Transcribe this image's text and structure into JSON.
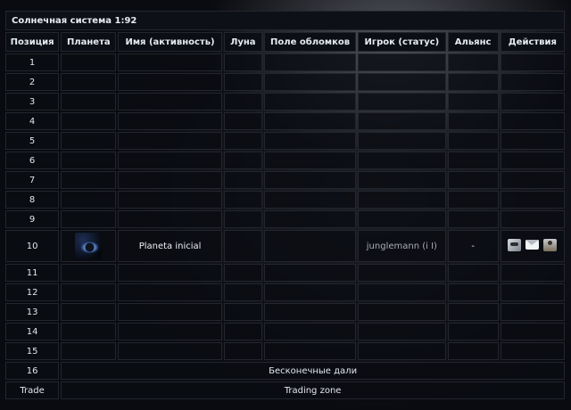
{
  "title": "Солнечная система 1:92",
  "headers": [
    "Позиция",
    "Планета",
    "Имя (активность)",
    "Луна",
    "Поле обломков",
    "Игрок (статус)",
    "Альянс",
    "Действия"
  ],
  "empty_positions_top": [
    "1",
    "2",
    "3",
    "4",
    "5",
    "6",
    "7",
    "8",
    "9"
  ],
  "occupied": {
    "position": "10",
    "planet_icon": "planet-thumbnail",
    "planet_name": "Planeta inicial",
    "moon": "",
    "debris": "",
    "player": "junglemann (i I)",
    "alliance": "-",
    "actions": [
      "spy-icon",
      "message-icon",
      "buddy-request-icon"
    ]
  },
  "empty_positions_bottom": [
    "11",
    "12",
    "13",
    "14",
    "15"
  ],
  "expedition": {
    "position": "16",
    "label": "Бесконечные дали"
  },
  "trade": {
    "position": "Trade",
    "label": "Trading zone"
  }
}
